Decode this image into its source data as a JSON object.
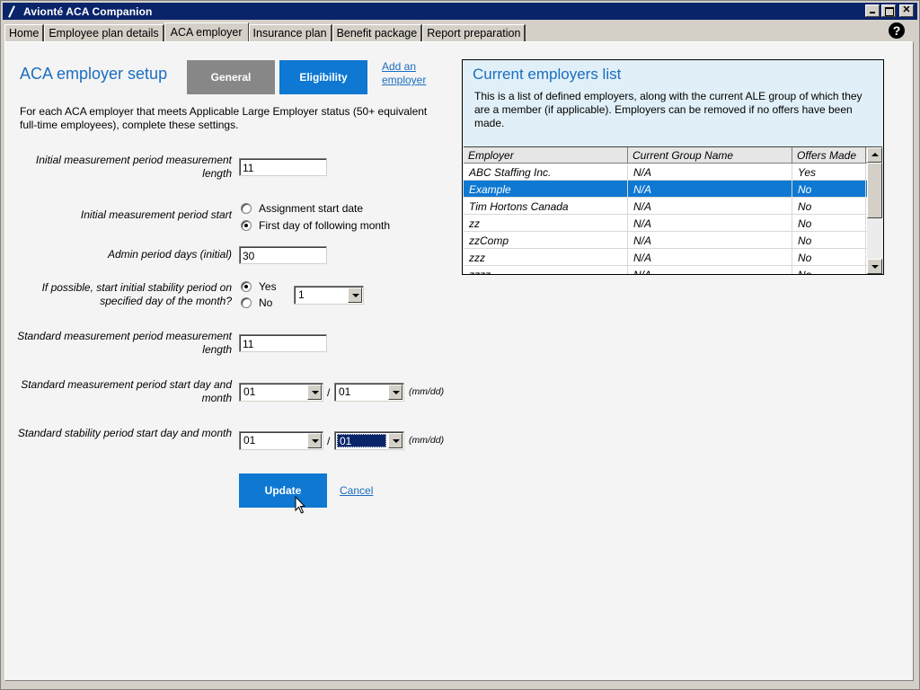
{
  "window": {
    "title": "Avionté ACA Companion"
  },
  "tabs": [
    {
      "label": "Home"
    },
    {
      "label": "Employee plan details"
    },
    {
      "label": "ACA employer"
    },
    {
      "label": "Insurance plan"
    },
    {
      "label": "Benefit package"
    },
    {
      "label": "Report preparation"
    }
  ],
  "help": {
    "glyph": "?"
  },
  "setup": {
    "title": "ACA employer setup",
    "general_label": "General",
    "eligibility_label": "Eligibility",
    "add_employer_label": "Add an employer",
    "intro": "For each ACA employer that meets Applicable Large Employer status (50+ equivalent full-time employees), complete these settings."
  },
  "form": {
    "initial_length_label": "Initial measurement period measurement length",
    "initial_length_value": "11",
    "initial_start_label": "Initial measurement period start",
    "opt_assignment": "Assignment start date",
    "opt_first_day": "First day of following month",
    "admin_days_label": "Admin period days (initial)",
    "admin_days_value": "30",
    "stability_question": "If possible, start initial stability period on specified day of the month?",
    "opt_yes": "Yes",
    "opt_no": "No",
    "stability_day_value": "1",
    "std_length_label": "Standard measurement period measurement length",
    "std_length_value": "11",
    "std_start_label": "Standard measurement period start day and month",
    "std_start_mm": "01",
    "std_start_dd": "01",
    "stab_start_label": "Standard stability period start day and month",
    "stab_start_mm": "01",
    "stab_start_dd": "01",
    "slash": "/",
    "mmdd_hint": "(mm/dd)",
    "update_label": "Update",
    "cancel_label": "Cancel"
  },
  "employers": {
    "title": "Current employers list",
    "description": "This is a list of defined employers, along with the current ALE group of which they are a member (if applicable). Employers can be removed if no offers have been made.",
    "columns": [
      "Employer",
      "Current Group Name",
      "Offers Made"
    ],
    "rows": [
      [
        "ABC Staffing Inc.",
        "N/A",
        "Yes"
      ],
      [
        "Example",
        "N/A",
        "No"
      ],
      [
        "Tim Hortons Canada",
        "N/A",
        "No"
      ],
      [
        "zz",
        "N/A",
        "No"
      ],
      [
        "zzComp",
        "N/A",
        "No"
      ],
      [
        "zzz",
        "N/A",
        "No"
      ],
      [
        "zzzz",
        "N/A",
        "No"
      ]
    ],
    "selected_index": 1
  },
  "colors": {
    "accent": "#0e78d2",
    "title_blue": "#1a6ec0",
    "titlebar": "#0a246a",
    "panel_bg": "#e1f0f8"
  }
}
